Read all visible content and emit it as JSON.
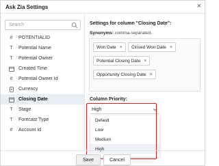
{
  "window": {
    "title": "Ask Zia Settings",
    "close_glyph": "×"
  },
  "sidebar": {
    "search_placeholder": "Search",
    "items": [
      {
        "icon": "hash-icon",
        "glyph": "#",
        "label": "POTENTIALID"
      },
      {
        "icon": "text-icon",
        "glyph": "T",
        "label": "Potential Name"
      },
      {
        "icon": "text-icon",
        "glyph": "T",
        "label": "Potential Owner"
      },
      {
        "icon": "calendar-icon",
        "glyph": "",
        "label": "Created Time"
      },
      {
        "icon": "hash-icon",
        "glyph": "#",
        "label": "Potential Owner Id"
      },
      {
        "icon": "currency-icon",
        "glyph": "",
        "label": "Currency"
      },
      {
        "icon": "calendar-icon",
        "glyph": "",
        "label": "Closing Date",
        "selected": true
      },
      {
        "icon": "text-icon",
        "glyph": "T",
        "label": "Stage"
      },
      {
        "icon": "text-icon",
        "glyph": "T",
        "label": "Forecast Type"
      },
      {
        "icon": "hash-icon",
        "glyph": "#",
        "label": "Account Id"
      }
    ]
  },
  "panel": {
    "heading": "Settings for column \"Closing Date\":",
    "synonyms_label": "Synonyms:",
    "synonyms_hint": "comma-separated.",
    "synonyms": [
      "Won Date",
      "Closed Won Date",
      "Potential Closing Date",
      "Opportunity Closing Date"
    ],
    "chip_remove_glyph": "×",
    "priority_label": "Column Priority:",
    "priority_value": "High",
    "priority_options": [
      "Default",
      "Low",
      "Medium",
      "High"
    ]
  },
  "footer": {
    "save_label": "Save",
    "cancel_label": "Cancel"
  },
  "colors": {
    "highlight": "#e02020",
    "selected_row": "#e9eef5"
  }
}
